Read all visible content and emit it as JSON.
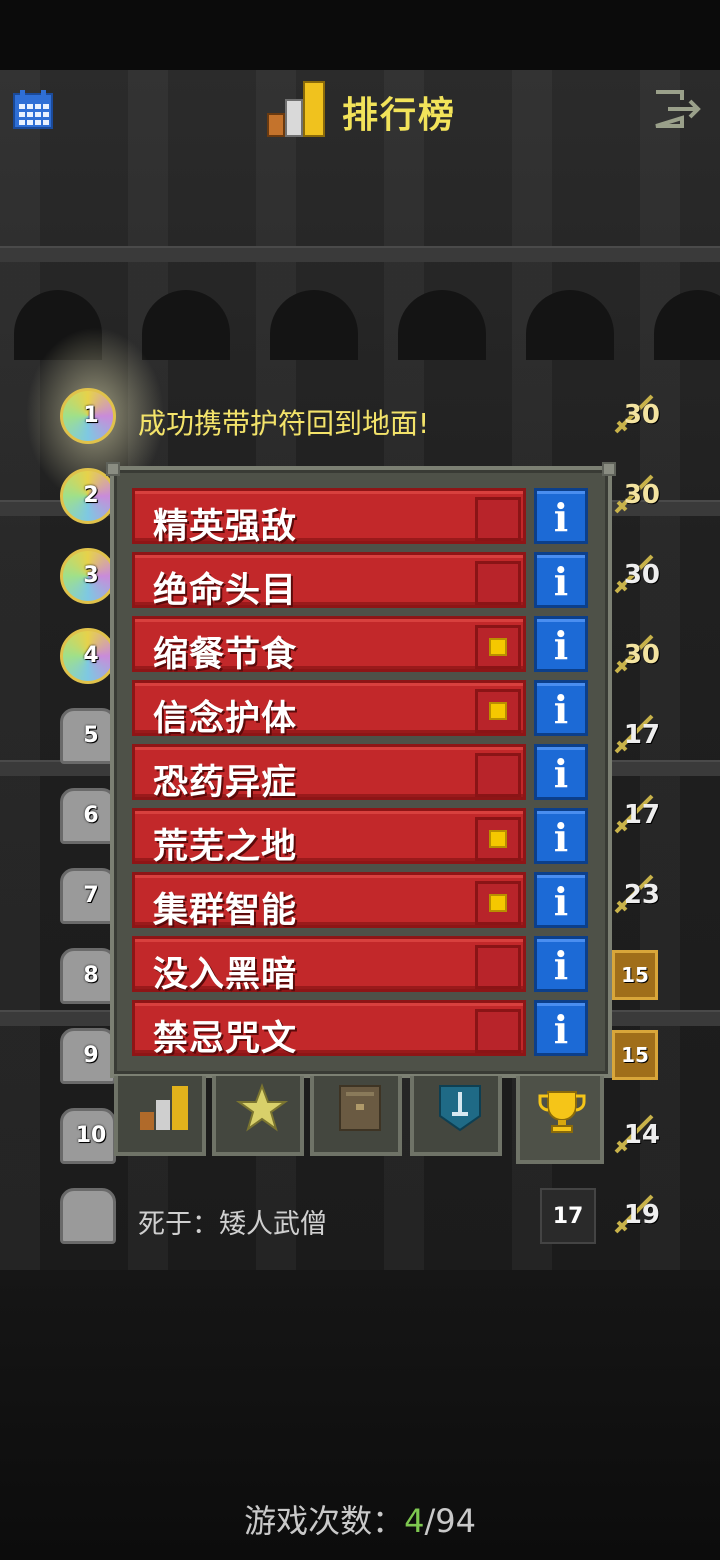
{
  "header": {
    "title": "排行榜"
  },
  "leaderboard": [
    {
      "rank": "1",
      "badge": "medal",
      "text": "成功携带护符回到地面!",
      "score": "30"
    },
    {
      "rank": "2",
      "badge": "medal",
      "score": "30"
    },
    {
      "rank": "3",
      "badge": "medal",
      "score": "30"
    },
    {
      "rank": "4",
      "badge": "medal",
      "score": "30"
    },
    {
      "rank": "5",
      "badge": "tomb",
      "score": "17"
    },
    {
      "rank": "6",
      "badge": "tomb",
      "score": "17"
    },
    {
      "rank": "7",
      "badge": "tomb",
      "score": "23"
    },
    {
      "rank": "8",
      "badge": "tomb",
      "chest": "15"
    },
    {
      "rank": "9",
      "badge": "tomb",
      "chest": "15"
    },
    {
      "rank": "10",
      "badge": "tomb",
      "score": "14"
    }
  ],
  "current_run": {
    "text": "死于：矮人武僧",
    "depth": "17",
    "score": "19"
  },
  "challenges": [
    {
      "label": "精英强敌",
      "checked": false
    },
    {
      "label": "绝命头目",
      "checked": false
    },
    {
      "label": "缩餐节食",
      "checked": true
    },
    {
      "label": "信念护体",
      "checked": true
    },
    {
      "label": "恐药异症",
      "checked": false
    },
    {
      "label": "荒芜之地",
      "checked": true
    },
    {
      "label": "集群智能",
      "checked": true
    },
    {
      "label": "没入黑暗",
      "checked": false
    },
    {
      "label": "禁忌咒文",
      "checked": false
    }
  ],
  "info_label": "i",
  "tabs": [
    {
      "icon": "rankings-icon"
    },
    {
      "icon": "badges-icon"
    },
    {
      "icon": "journal-icon"
    },
    {
      "icon": "hero-icon"
    },
    {
      "icon": "trophy-icon",
      "active": true
    }
  ],
  "footer": {
    "label": "游戏次数：",
    "current": "4",
    "separator": "/",
    "total": "94"
  },
  "colors": {
    "title": "#f2e35a",
    "challenge_red": "#c2282a",
    "info_blue": "#1c6ad6",
    "checked_yellow": "#f5c800",
    "games_current": "#7ec850"
  }
}
